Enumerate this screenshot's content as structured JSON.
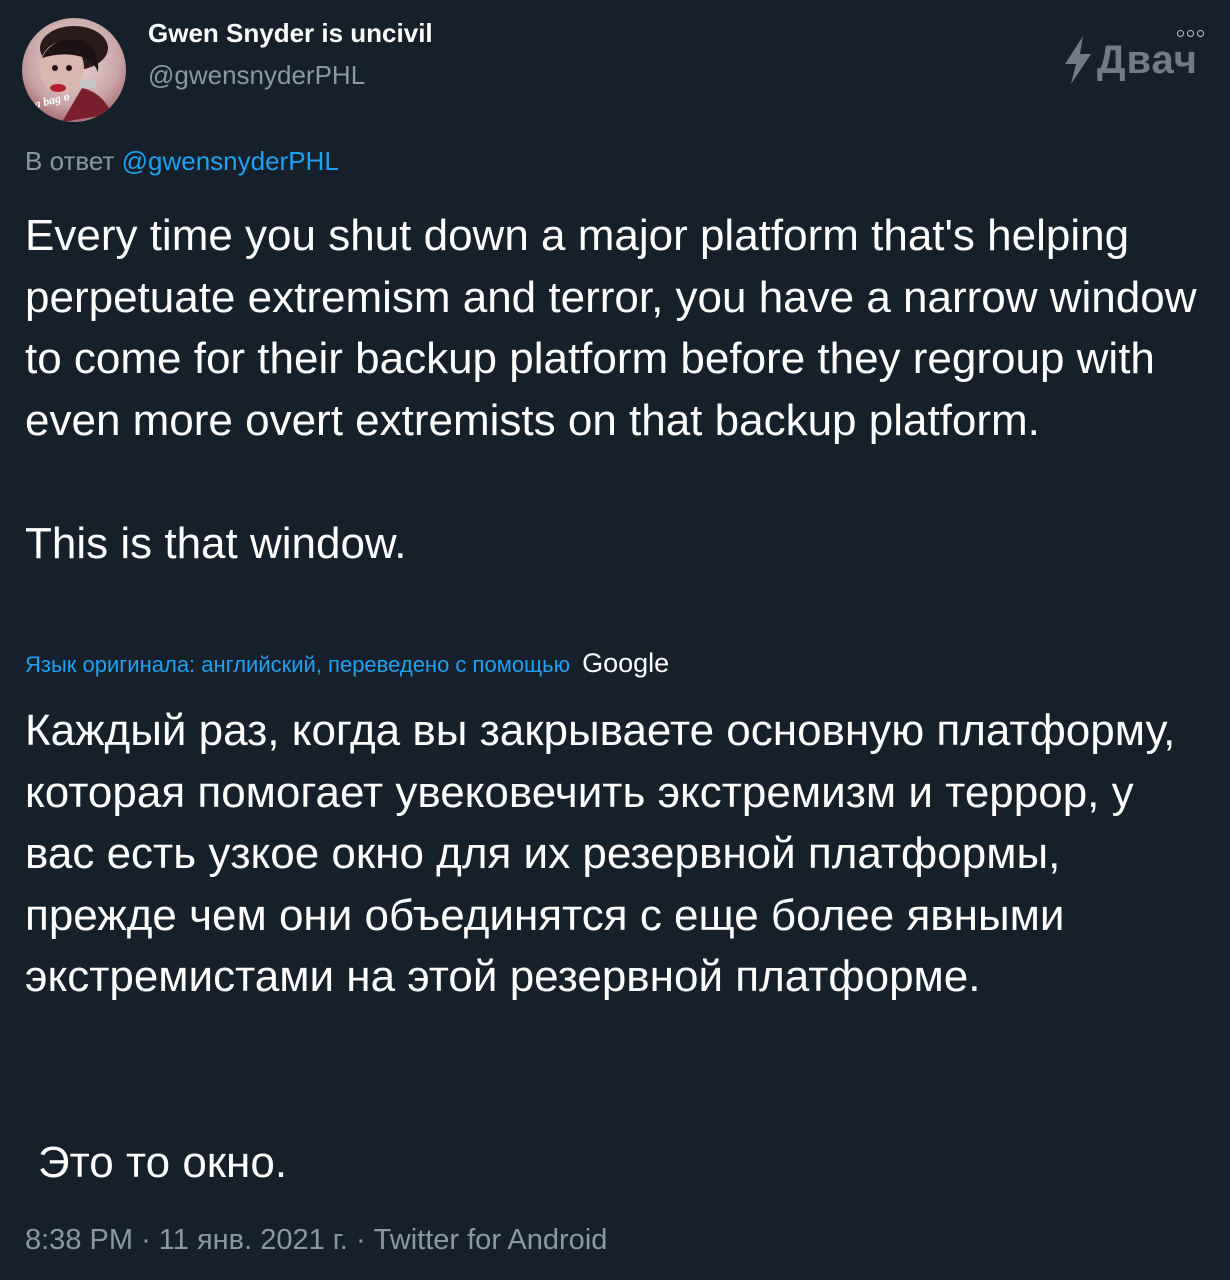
{
  "author": {
    "display_name": "Gwen Snyder is uncivil",
    "handle": "@gwensnyderPHL",
    "avatar_caption": "a bag o"
  },
  "watermark": {
    "icon": "lightning-bolt-icon",
    "text": "Двач"
  },
  "more_icon": "three-dots-icon",
  "reply": {
    "prefix": "В ответ",
    "mention": "@gwensnyderPHL"
  },
  "tweet": {
    "paragraph_1": "Every time you shut down a major platform that's helping perpetuate extremism and terror, you have a narrow window to come for their backup platform before they regroup with even more overt extremists on that backup platform.",
    "paragraph_2": "This is that window."
  },
  "translation": {
    "note": "Язык оригинала: английский, переведено с помощью",
    "provider": "Google",
    "paragraph_1": "Каждый раз, когда вы закрываете основную платформу, которая помогает увековечить экстремизм и террор, у вас есть узкое окно для их резервной платформы, прежде чем они объединятся с еще более явными экстремистами на этой резервной платформе.",
    "paragraph_2": "Это то окно."
  },
  "meta": {
    "time": "8:38 PM",
    "separator": "·",
    "date": "11 янв. 2021 г.",
    "source": "Twitter for Android"
  },
  "colors": {
    "background": "#15202b",
    "link": "#1da1f2",
    "secondary_text": "#8899a6",
    "primary_text": "#ffffff"
  }
}
